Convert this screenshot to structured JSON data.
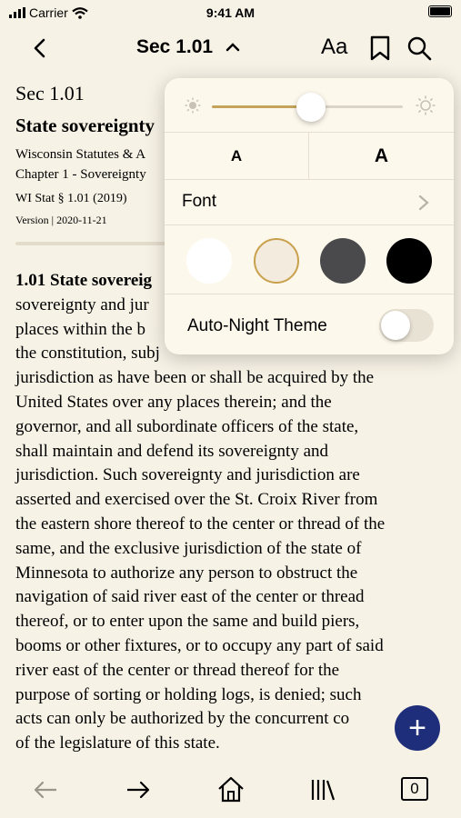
{
  "status_bar": {
    "carrier": "Carrier",
    "time": "9:41 AM"
  },
  "nav": {
    "title": "Sec 1.01",
    "font_settings_label": "Aa"
  },
  "document": {
    "section": "Sec 1.01",
    "heading": "State sovereignty",
    "source_line_1": "Wisconsin Statutes & A",
    "source_line_2": "Chapter 1 - Sovereignty",
    "citation": "WI Stat § 1.01 (2019)",
    "version": "Version | 2020-11-21",
    "body_heading": "1.01 State sovereig",
    "body_lines": [
      "sovereignty and jur",
      "places within the b",
      "the constitution, subj",
      "jurisdiction as have been or shall be acquired by the",
      "United States over any places therein; and the",
      "governor, and all subordinate officers of the state,",
      "shall maintain and defend its sovereignty and",
      "jurisdiction. Such sovereignty and jurisdiction are",
      "asserted and exercised over the St. Croix River from",
      "the eastern shore thereof to the center or thread of the",
      "same, and the exclusive jurisdiction of the state of",
      "Minnesota to authorize any person to obstruct the",
      "navigation of said river east of the center or thread",
      "thereof, or to enter upon the same and build piers,",
      "booms or other fixtures, or to occupy any part of said",
      "river east of the center or thread thereof for the",
      "purpose of sorting or holding logs, is denied; such",
      "acts can only be authorized by the concurrent co",
      "of the legislature of this state."
    ]
  },
  "popover": {
    "brightness_level": 0.52,
    "font_size_small_label": "A",
    "font_size_large_label": "A",
    "font_label": "Font",
    "themes": [
      "white",
      "sepia",
      "gray",
      "black"
    ],
    "selected_theme": "sepia",
    "auto_night_label": "Auto-Night Theme",
    "auto_night_on": false
  },
  "fab": {
    "label": "+"
  },
  "toolbar": {
    "tabs_count": "0"
  },
  "colors": {
    "background": "#f7f2e6",
    "accent": "#c5a35a",
    "fab": "#1f2e7a"
  }
}
